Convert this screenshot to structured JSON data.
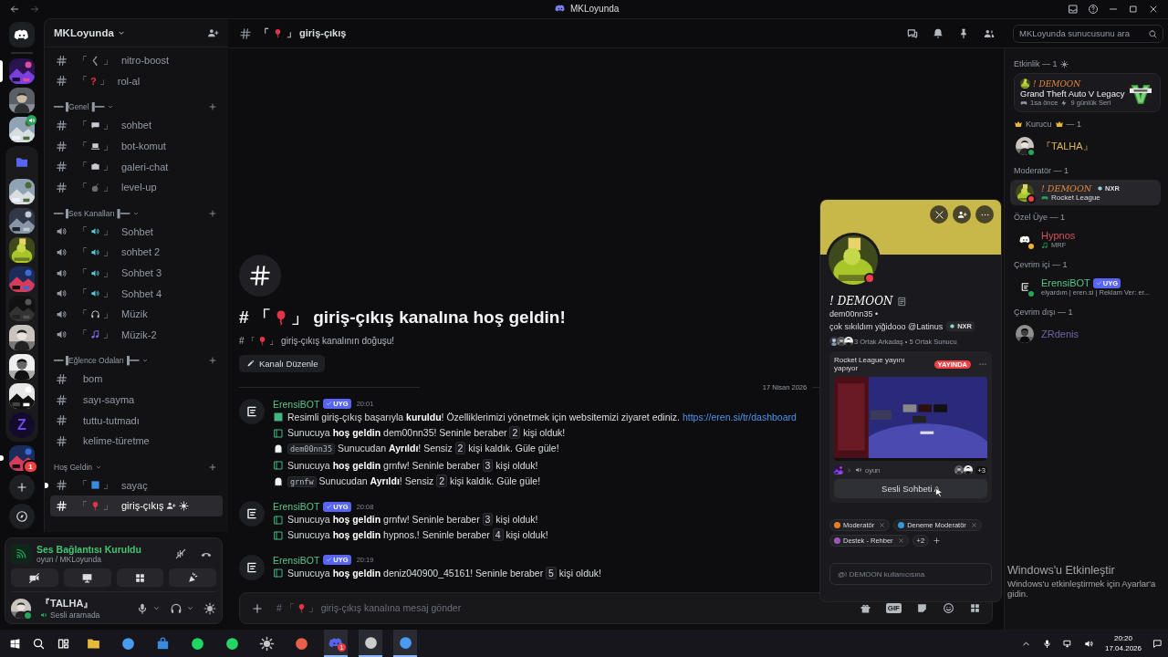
{
  "titlebar": {
    "title": "MKLoyunda"
  },
  "servers": [
    {
      "kind": "home",
      "selected": false,
      "unread": false
    },
    {
      "kind": "picture",
      "selected": true,
      "unread": false,
      "voice": false
    },
    {
      "kind": "picture",
      "selected": false,
      "unread": false,
      "voice": false
    },
    {
      "kind": "picture",
      "selected": false,
      "unread": false,
      "voice": true
    },
    {
      "kind": "folder",
      "expanded": true,
      "children": [
        {
          "kind": "picture",
          "selected": false
        },
        {
          "kind": "picture",
          "selected": false
        },
        {
          "kind": "picture",
          "selected": false
        },
        {
          "kind": "picture",
          "selected": false
        },
        {
          "kind": "picture",
          "selected": false
        },
        {
          "kind": "picture",
          "selected": false
        },
        {
          "kind": "picture",
          "selected": false
        },
        {
          "kind": "picture",
          "selected": false
        },
        {
          "kind": "letter",
          "text": "Z",
          "selected": false
        }
      ]
    },
    {
      "kind": "picture",
      "selected": false,
      "unread": true,
      "badge": "1"
    },
    {
      "kind": "add"
    },
    {
      "kind": "explore"
    }
  ],
  "server_name": "MKLoyunda",
  "categories": [
    {
      "channels": [
        {
          "kind": "text",
          "open": "「",
          "symbol": "く",
          "close": "」",
          "name": "nitro-boost",
          "selected": false,
          "unread": false
        },
        {
          "kind": "text",
          "open": "「",
          "symbol": "?",
          "close": "」",
          "name": "rol-al",
          "selected": false,
          "unread": false
        }
      ]
    },
    {
      "name": "━━▐Genel▐━━",
      "channels": [
        {
          "kind": "text",
          "open": "「",
          "close": "」",
          "name": "sohbet",
          "selected": false,
          "unread": false
        },
        {
          "kind": "text",
          "open": "「",
          "close": "」",
          "name": "bot-komut",
          "selected": false,
          "unread": false
        },
        {
          "kind": "text",
          "open": "「",
          "close": "」",
          "name": "galeri-chat",
          "selected": false,
          "unread": false
        },
        {
          "kind": "text",
          "open": "「",
          "close": "」",
          "name": "level-up",
          "selected": false,
          "unread": false
        }
      ]
    },
    {
      "name": "━━▐Ses Kanalları▐━━",
      "channels": [
        {
          "kind": "voice",
          "open": "「",
          "close": "」",
          "name": "Sohbet",
          "selected": false,
          "unread": false
        },
        {
          "kind": "voice",
          "open": "「",
          "close": "」",
          "name": "sohbet 2",
          "selected": false,
          "unread": false
        },
        {
          "kind": "voice",
          "open": "「",
          "close": "」",
          "name": "Sohbet 3",
          "selected": false,
          "unread": false
        },
        {
          "kind": "voice",
          "open": "「",
          "close": "」",
          "name": "Sohbet 4",
          "selected": false,
          "unread": false
        },
        {
          "kind": "voice",
          "open": "「",
          "close": "」",
          "name": "Müzik",
          "selected": false,
          "unread": false
        },
        {
          "kind": "voice",
          "open": "「",
          "close": "」",
          "name": "Müzik-2",
          "selected": false,
          "unread": false
        }
      ]
    },
    {
      "name": "━━▐Eğlence Odaları▐━━",
      "channels": [
        {
          "kind": "text",
          "name": "bom",
          "selected": false,
          "unread": false
        },
        {
          "kind": "text",
          "name": "sayı-sayma",
          "selected": false,
          "unread": false
        },
        {
          "kind": "text",
          "name": "tuttu-tutmadı",
          "selected": false,
          "unread": false
        },
        {
          "kind": "text",
          "name": "kelime-türetme",
          "selected": false,
          "unread": false
        }
      ]
    },
    {
      "name": "Hoş Geldin",
      "channels": [
        {
          "kind": "text",
          "open": "「",
          "close": "」",
          "name": "sayaç",
          "selected": false,
          "unread": true
        },
        {
          "kind": "text",
          "open": "「",
          "close": "」",
          "name": "giriş-çıkış",
          "selected": true,
          "unread": false
        }
      ]
    }
  ],
  "voice_panel": {
    "title": "Ses Bağlantısı Kuruldu",
    "channel": "oyun / MKLoyunda"
  },
  "user_panel": {
    "name": "『TALHA』",
    "status": "Sesli aramada"
  },
  "channel_header": {
    "open": "「",
    "close": "」",
    "name": "giriş-çıkış",
    "search_placeholder": "MKLoyunda sunucusunu ara"
  },
  "welcome": {
    "title_open": "# 「",
    "title_rest": "」 giriş-çıkış kanalına hoş geldin!",
    "subtitle_open": "# 「",
    "subtitle_rest": "」 giriş-çıkış kanalının doğuşu!",
    "button": "Kanalı Düzenle",
    "date": "17 Nisan 2026"
  },
  "messages": [
    {
      "author": "ErensiBOT",
      "tag": "UYG",
      "time": "20:01",
      "lines": [
        {
          "kind": "setup",
          "parts": [
            {
              "kind": "text",
              "text": "Resimli giriş-çıkış başarıyla **kuruldu**! Özelliklerimizi yönetmek için websitemizi ziyaret ediniz. "
            },
            {
              "kind": "link",
              "text": "https://eren.si/tr/dashboard"
            }
          ]
        },
        {
          "kind": "join",
          "parts": [
            {
              "kind": "text",
              "text": "Sunucuya **hoş geldin** dem00nn35! Seninle beraber "
            },
            {
              "kind": "number",
              "text": "2"
            },
            {
              "kind": "text",
              "text": " kişi olduk!"
            }
          ]
        },
        {
          "kind": "leave",
          "parts": [
            {
              "kind": "code",
              "text": "dem00nn35"
            },
            {
              "kind": "text",
              "text": " Sunucudan **Ayrıldı**! Sensiz "
            },
            {
              "kind": "number",
              "text": "2"
            },
            {
              "kind": "text",
              "text": " kişi kaldık. Güle güle!"
            }
          ]
        },
        {
          "kind": "join",
          "parts": [
            {
              "kind": "text",
              "text": "Sunucuya **hoş geldin** grnfw! Seninle beraber "
            },
            {
              "kind": "number",
              "text": "3"
            },
            {
              "kind": "text",
              "text": " kişi olduk!"
            }
          ]
        },
        {
          "kind": "leave",
          "parts": [
            {
              "kind": "code",
              "text": "grnfw"
            },
            {
              "kind": "text",
              "text": " Sunucudan **Ayrıldı**! Sensiz "
            },
            {
              "kind": "number",
              "text": "2"
            },
            {
              "kind": "text",
              "text": " kişi kaldık. Güle güle!"
            }
          ]
        }
      ]
    },
    {
      "author": "ErensiBOT",
      "tag": "UYG",
      "time": "20:08",
      "lines": [
        {
          "kind": "join",
          "parts": [
            {
              "kind": "text",
              "text": "Sunucuya **hoş geldin** grnfw! Seninle beraber "
            },
            {
              "kind": "number",
              "text": "3"
            },
            {
              "kind": "text",
              "text": " kişi olduk!"
            }
          ]
        },
        {
          "kind": "join",
          "parts": [
            {
              "kind": "text",
              "text": "Sunucuya **hoş geldin** hypnos.! Seninle beraber "
            },
            {
              "kind": "number",
              "text": "4"
            },
            {
              "kind": "text",
              "text": " kişi olduk!"
            }
          ]
        }
      ]
    },
    {
      "author": "ErensiBOT",
      "tag": "UYG",
      "time": "20:19",
      "lines": [
        {
          "kind": "join",
          "parts": [
            {
              "kind": "text",
              "text": "Sunucuya **hoş geldin** deniz040900_45161! Seninle beraber "
            },
            {
              "kind": "number",
              "text": "5"
            },
            {
              "kind": "text",
              "text": " kişi olduk!"
            }
          ]
        }
      ]
    }
  ],
  "composer": {
    "open": "# 「",
    "placeholder": "」 giriş-çıkış kanalına mesaj gönder",
    "gif": "GIF"
  },
  "activity_section": {
    "heading": "Etkinlik — 1",
    "user": "! DEMOON",
    "game": "Grand Theft Auto V Legacy",
    "time": "1sa önce",
    "streak": "9 günlük Seri"
  },
  "member_groups": [
    {
      "heading": "Kurucu",
      "count": "— 1",
      "crowns": true,
      "members": [
        {
          "name": "『TALHA』",
          "color": "#d9b45a",
          "status": {
            "color": "#23a55a"
          },
          "selected": false
        }
      ]
    },
    {
      "heading": "Moderatör — 1",
      "crowns": false,
      "members": [
        {
          "name": "! DEMOON",
          "color": "#e8893a",
          "status": {
            "color": "#f23f43"
          },
          "tag": "NXR",
          "activity": "Rocket League",
          "selected": true
        }
      ]
    },
    {
      "heading": "Özel Üye — 1",
      "crowns": false,
      "members": [
        {
          "name": "Hypnos",
          "color": "#d2525a",
          "status": {
            "color": "#f0b232"
          },
          "activity": "MRF",
          "selected": false
        }
      ]
    },
    {
      "heading": "Çevrim içi — 1",
      "crowns": false,
      "members": [
        {
          "name": "ErensiBOT",
          "color": "#57c58a",
          "status": {
            "color": "#23a55a"
          },
          "bot_tag": "UYG",
          "activity": "elyardım | eren.si | Reklam Ver: er...",
          "selected": false
        }
      ]
    },
    {
      "heading": "Çevrim dışı — 1",
      "crowns": false,
      "members": [
        {
          "name": "ZRdenis",
          "color": "#6f66a8",
          "selected": false
        }
      ]
    }
  ],
  "profile": {
    "name": "! DEMOON",
    "username": "dem00nn35 •",
    "bio": "çok sıkıldım yiğidooo @Latinus",
    "tag": "NXR",
    "mutuals": "3 Ortak Arkadaş • 5 Ortak Sunucu",
    "status": {
      "color": "#f23f43"
    },
    "stream": {
      "title": "Rocket League yayını yapıyor",
      "live": "YAYINDA",
      "channel": "oyun",
      "extra": "+3",
      "button": "Sesli Sohbeti A"
    },
    "roles": [
      {
        "name": "Moderatör",
        "color": "#e67e22"
      },
      {
        "name": "Deneme Moderatör",
        "color": "#3498db"
      },
      {
        "name": "Destek - Rehber",
        "color": "#9b59b6"
      }
    ],
    "more_roles": "+2",
    "message_placeholder": "@! DEMOON kullanıcısına"
  },
  "activation_notice": {
    "title": "Windows'u Etkinleştir",
    "text": "Windows'u etkinleştirmek için Ayarlar'a gidin."
  },
  "taskbar": {
    "apps": [
      {
        "kind": "search"
      },
      {
        "kind": "taskview"
      },
      {
        "kind": "explorer",
        "running": false
      },
      {
        "kind": "chrome",
        "running": false
      },
      {
        "kind": "store",
        "running": false
      },
      {
        "kind": "spotify",
        "running": false
      },
      {
        "kind": "whatsapp",
        "running": false
      },
      {
        "kind": "steam",
        "running": false
      },
      {
        "kind": "photos",
        "running": false
      },
      {
        "kind": "discord",
        "running": true,
        "badge": "1"
      },
      {
        "kind": "capture",
        "running": true
      },
      {
        "kind": "chrome",
        "running": true
      }
    ],
    "time": "20:20",
    "date": "17.04.2026"
  }
}
